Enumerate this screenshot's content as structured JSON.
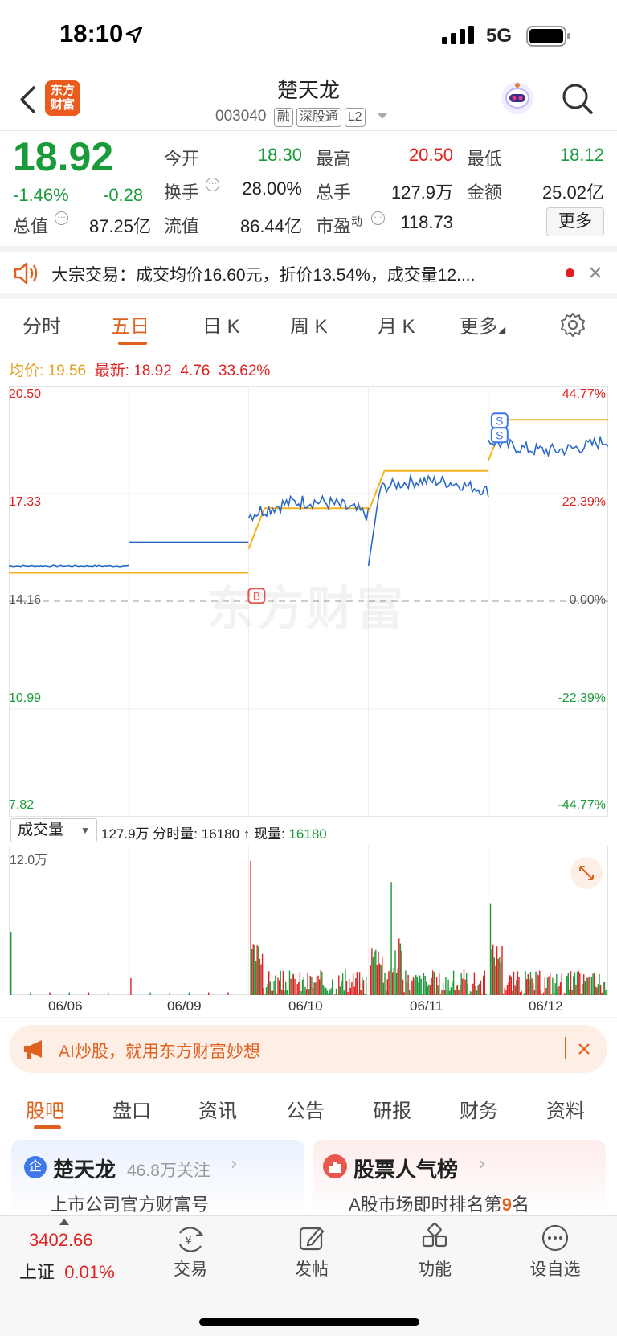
{
  "status_bar": {
    "time": "18:10",
    "network": "5G"
  },
  "header": {
    "logo_text": "东方财富",
    "stock_name": "楚天龙",
    "stock_code": "003040",
    "tags": [
      "融",
      "深股通",
      "L2"
    ]
  },
  "quote": {
    "price": "18.92",
    "change_pct": "-1.46%",
    "change_abs": "-0.28",
    "fields": {
      "open_label": "今开",
      "open": "18.30",
      "high_label": "最高",
      "high": "20.50",
      "low_label": "最低",
      "low": "18.12",
      "turnover_label": "换手",
      "turnover": "28.00%",
      "volume_label": "总手",
      "volume": "127.9万",
      "amount_label": "金额",
      "amount": "25.02亿",
      "mktcap_label": "总值",
      "mktcap": "87.25亿",
      "float_label": "流值",
      "float": "86.44亿",
      "pe_label": "市盈",
      "pe_sup": "动",
      "pe": "118.73"
    },
    "more_label": "更多"
  },
  "notice": {
    "text": "大宗交易：成交均价16.60元，折价13.54%，成交量12...."
  },
  "chart_tabs": {
    "items": [
      "分时",
      "五日",
      "日 K",
      "周 K",
      "月 K",
      "更多"
    ],
    "active_index": 1
  },
  "chart_info": {
    "avg_label": "均价:",
    "avg_value": "19.56",
    "latest_label": "最新:",
    "latest_value": "18.92",
    "change_value": "4.76",
    "change_pct": "33.62%"
  },
  "chart_data": {
    "type": "line",
    "title": "",
    "xlabel": "",
    "ylabel": "",
    "ylim": [
      7.82,
      20.5
    ],
    "y_ticks_left": [
      "20.50",
      "17.33",
      "14.16",
      "10.99",
      "7.82"
    ],
    "y_ticks_right": [
      "44.77%",
      "22.39%",
      "0.00%",
      "-22.39%",
      "-44.77%"
    ],
    "categories": [
      "06/06",
      "06/09",
      "06/10",
      "06/11",
      "06/12"
    ],
    "series": [
      {
        "values": [
          15.2,
          15.9,
          16.7,
          17.4,
          18.9
        ]
      },
      {
        "values": [
          15.0,
          15.0,
          16.9,
          18.0,
          19.5
        ]
      }
    ],
    "markers": [
      {
        "label": "B",
        "day": "06/10"
      },
      {
        "label": "S",
        "day": "06/12"
      },
      {
        "label": "S",
        "day": "06/12"
      }
    ],
    "grid": true
  },
  "volume": {
    "selector": "成交量",
    "total": "127.9万",
    "minute_label": "分时量:",
    "minute_value": "16180",
    "current_label": "现量:",
    "current_value": "16180",
    "ymax": "12.0万"
  },
  "ai_banner": {
    "text": "AI炒股，就用东方财富妙想"
  },
  "bottom_tabs": {
    "items": [
      "股吧",
      "盘口",
      "资讯",
      "公告",
      "研报",
      "财务",
      "资料"
    ],
    "active_index": 0
  },
  "cards": {
    "company": {
      "badge": "企",
      "title": "楚天龙",
      "followers": "46.8万关注",
      "desc": "上市公司官方财富号"
    },
    "ranking": {
      "title": "股票人气榜",
      "desc_prefix": "A股市场即时排名第",
      "rank": "9",
      "desc_suffix": "名"
    }
  },
  "nav": {
    "index_value": "3402.66",
    "index_name": "上证",
    "index_change": "0.01%",
    "items": [
      "交易",
      "发帖",
      "功能",
      "设自选"
    ]
  },
  "colors": {
    "accent": "#e0601e",
    "up": "#e02020",
    "down": "#1a9b3a",
    "price_line": "#2a68c8",
    "avg_line": "#f5b21f"
  }
}
